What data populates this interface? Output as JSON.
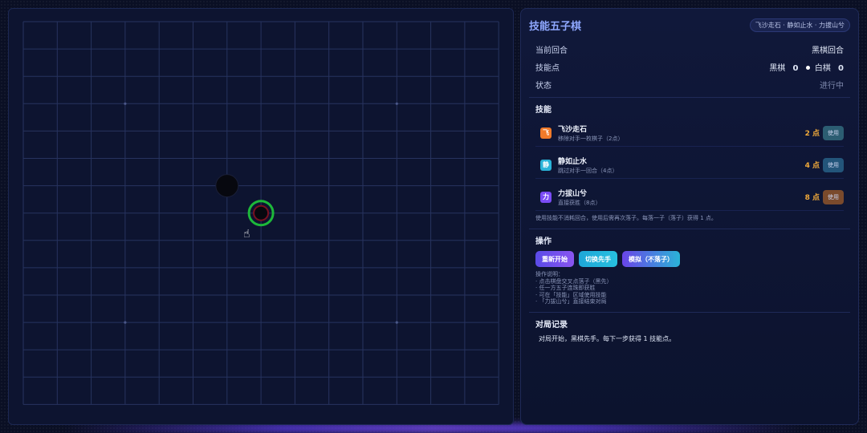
{
  "panel": {
    "title": "技能五子棋",
    "tagline": "飞沙走石 · 静如止水 · 力拔山兮"
  },
  "status": {
    "turn_label": "当前回合",
    "turn_value": "黑棋回合",
    "points_label": "技能点",
    "black_label": "黑棋",
    "black_points": "0",
    "white_label": "白棋",
    "white_points": "0",
    "state_label": "状态",
    "state_value": "进行中"
  },
  "skills": {
    "title": "技能",
    "items": [
      {
        "icon": "飞",
        "name": "飞沙走石",
        "desc": "移除对手一枚棋子（2点）",
        "cost": "2 点",
        "button": "使用",
        "color": "#f07a2a"
      },
      {
        "icon": "静",
        "name": "静如止水",
        "desc": "跳过对手一回合（4点）",
        "cost": "4 点",
        "button": "使用",
        "color": "#2ab3d8"
      },
      {
        "icon": "力",
        "name": "力拔山兮",
        "desc": "直接获胜（8点）",
        "cost": "8 点",
        "button": "使用",
        "color": "#7a4cf5"
      }
    ],
    "note": "使用技能不消耗回合，使用后需再次落子。每落一子（落子）获得 1 点。"
  },
  "ops": {
    "title": "操作",
    "buttons": [
      "重新开始",
      "切换先手",
      "模拟（不落子）"
    ],
    "help": [
      "操作说明：",
      "· 点击棋盘交叉点落子（黑先）",
      "· 任一方五子连珠即获胜",
      "· 可在「技能」区域使用技能",
      "· 「力拔山兮」直接结束对局"
    ]
  },
  "log": {
    "title": "对局记录",
    "entry": "对局开始，黑棋先手。每下一步获得 1 技能点。"
  },
  "colors": {
    "accent": "#8fa8ff",
    "cost": "#f0a93a",
    "highlight": "#1db83a"
  },
  "board": {
    "size": 15,
    "stones": [
      {
        "col": 6,
        "row": 6,
        "color": "black"
      },
      {
        "col": 7,
        "row": 7,
        "color": "black",
        "highlighted": true
      }
    ]
  }
}
